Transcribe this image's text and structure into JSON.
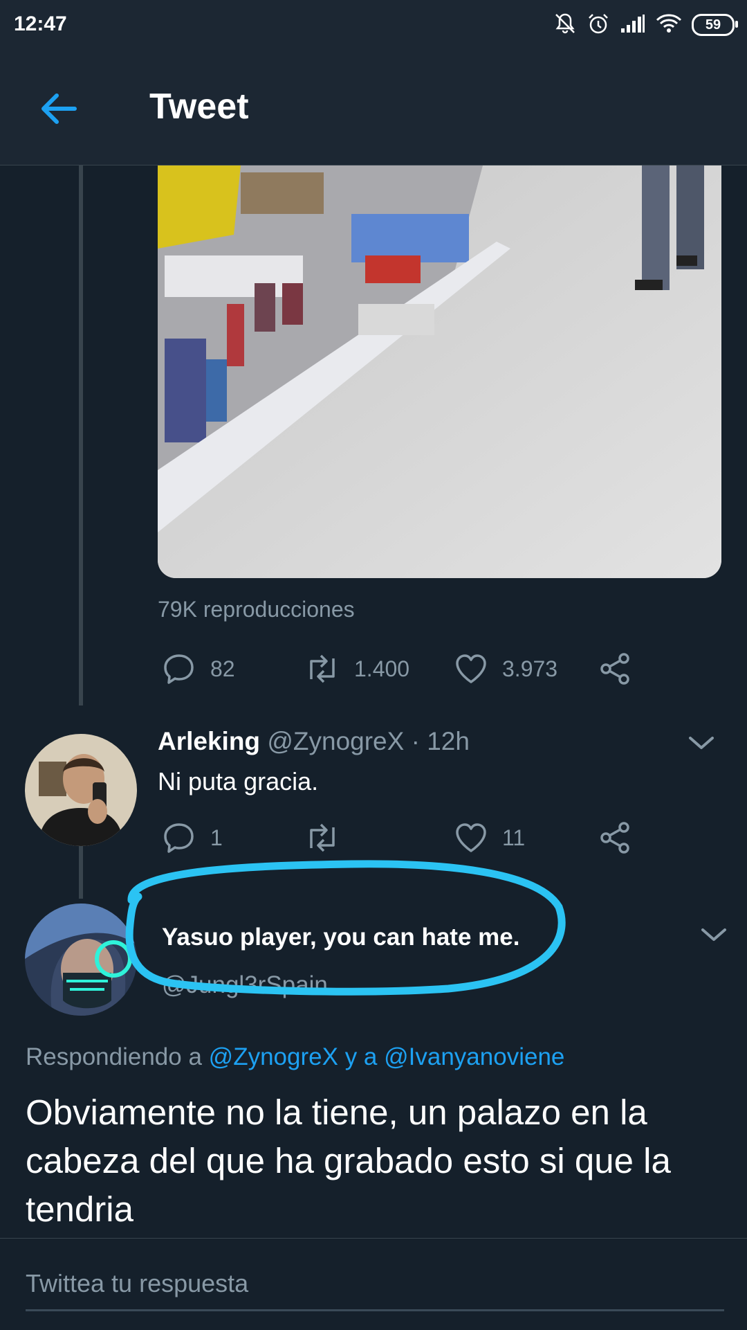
{
  "status_bar": {
    "time": "12:47",
    "battery": "59"
  },
  "header": {
    "title": "Tweet"
  },
  "main_tweet": {
    "views": "79K reproducciones",
    "reply_count": "82",
    "retweet_count": "1.400",
    "like_count": "3.973"
  },
  "reply": {
    "display_name": "Arleking",
    "handle": "@ZynogreX",
    "separator": "·",
    "time": "12h",
    "text": "Ni puta gracia.",
    "reply_count": "1",
    "like_count": "11"
  },
  "focused_tweet": {
    "display_name": "Yasuo player, you can hate me.",
    "handle": "@Jungl3rSpain",
    "replying_prefix": "Respondiendo a",
    "mention_1": "@ZynogreX",
    "conjunction": "y a",
    "mention_2": "@Ivanyanoviene",
    "text": "Obviamente no la tiene, un palazo en la cabeza del que ha grabado esto si que la tendria",
    "highlight_color": "#2bc3f3"
  },
  "compose": {
    "placeholder": "Twittea tu respuesta"
  },
  "colors": {
    "background": "#15202b",
    "accent": "#1da1f2",
    "muted": "#8899a6"
  }
}
